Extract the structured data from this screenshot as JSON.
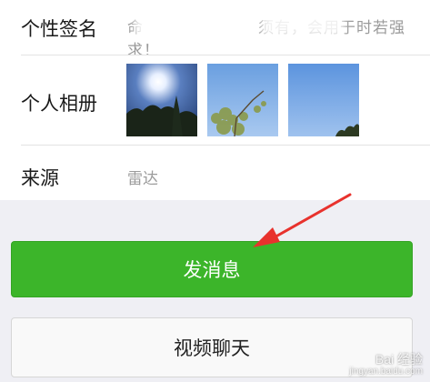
{
  "profile": {
    "signature_label": "个性签名",
    "signature_text": "命　　　　　　　须有，会用于时若强求！",
    "album_label": "个人相册",
    "source_label": "来源",
    "source_value": "雷达"
  },
  "actions": {
    "send_message_label": "发消息",
    "video_chat_label": "视频聊天"
  },
  "watermark": {
    "brand": "Bai 经验",
    "url": "jingyan.baidu.com"
  },
  "colors": {
    "accent_green": "#3cb52a",
    "annotation_red": "#e8322d"
  }
}
